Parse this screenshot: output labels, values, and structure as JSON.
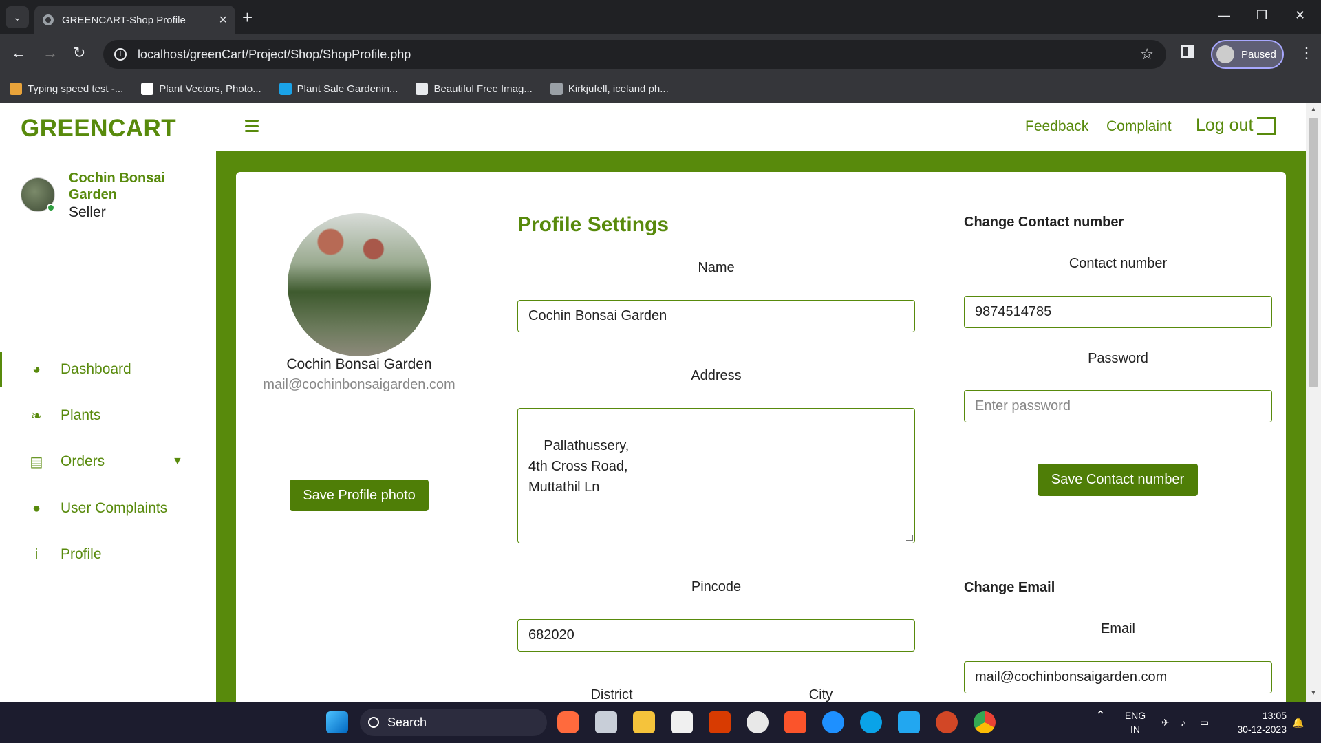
{
  "browser": {
    "tab_title": "GREENCART-Shop Profile",
    "url": "localhost/greenCart/Project/Shop/ShopProfile.php",
    "profile_status": "Paused",
    "bookmarks": [
      {
        "label": "Typing speed test -...",
        "color": "#e8a33a"
      },
      {
        "label": "Plant Vectors, Photo...",
        "color": "#ffffff"
      },
      {
        "label": "Plant Sale Gardenin...",
        "color": "#1aa3e8"
      },
      {
        "label": "Beautiful Free Imag...",
        "color": "#e8eaed"
      },
      {
        "label": "Kirkjufell, iceland ph...",
        "color": "#9aa0a6"
      }
    ]
  },
  "sidebar": {
    "brand": "GREENCART",
    "user_name": "Cochin Bonsai Garden",
    "user_role": "Seller",
    "items": [
      {
        "label": "Dashboard",
        "icon": "gauge-icon"
      },
      {
        "label": "Plants",
        "icon": "leaf-icon"
      },
      {
        "label": "Orders",
        "icon": "book-icon"
      },
      {
        "label": "User Complaints",
        "icon": "chat-bubble-icon"
      },
      {
        "label": "Profile",
        "icon": "person-icon"
      }
    ]
  },
  "topnav": {
    "feedback": "Feedback",
    "complaint": "Complaint",
    "logout": "Log out"
  },
  "profile_card": {
    "name": "Cochin Bonsai Garden",
    "email": "mail@cochinbonsaigarden.com",
    "save_photo": "Save Profile photo"
  },
  "settings": {
    "title": "Profile Settings",
    "name_label": "Name",
    "name_value": "Cochin Bonsai Garden",
    "address_label": "Address",
    "address_value": "Pallathussery,\n4th Cross Road,\nMuttathil Ln",
    "pincode_label": "Pincode",
    "pincode_value": "682020",
    "district_label": "District",
    "city_label": "City"
  },
  "contact": {
    "title": "Change Contact number",
    "contact_label": "Contact number",
    "contact_value": "9874514785",
    "password_label": "Password",
    "password_placeholder": "Enter password",
    "save_label": "Save Contact number"
  },
  "email_section": {
    "title": "Change Email",
    "email_label": "Email",
    "email_value": "mail@cochinbonsaigarden.com"
  },
  "taskbar": {
    "search": "Search",
    "lang": "ENG",
    "region": "IN",
    "time": "13:05",
    "date": "30-12-2023"
  },
  "colors": {
    "brand_green": "#588a0c",
    "button_green": "#4f7e07"
  }
}
